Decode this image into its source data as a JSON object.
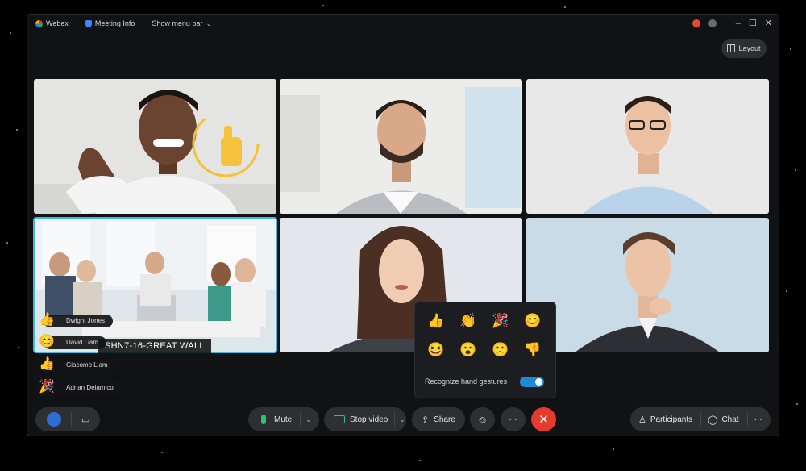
{
  "titlebar": {
    "app_name": "Webex",
    "meeting_info": "Meeting Info",
    "show_menu_bar": "Show menu bar"
  },
  "window_controls": {
    "minimize": "–",
    "maximize": "☐",
    "close": "✕"
  },
  "layout_button": {
    "label": "Layout"
  },
  "room_label": "SHN7-16-GREAT WALL",
  "participants_overlay": [
    {
      "name": "Dwight Jones",
      "emoji": "👍"
    },
    {
      "name": "David Liam",
      "emoji": "😊"
    },
    {
      "name": "Giacomo Liam",
      "emoji": "👍"
    },
    {
      "name": "Adrian Delamico",
      "emoji": "🎉"
    }
  ],
  "reactions_panel": {
    "row1": [
      "👍",
      "👏",
      "🎉",
      "😊"
    ],
    "row2": [
      "😆",
      "😮",
      "🙁",
      "👎"
    ],
    "gesture_label": "Recognize hand gestures",
    "gesture_enabled": true
  },
  "bottombar": {
    "mute_label": "Mute",
    "stop_video_label": "Stop video",
    "share_label": "Share",
    "more_label": "···",
    "participants_label": "Participants",
    "chat_label": "Chat",
    "overflow_label": "···"
  },
  "colors": {
    "accent": "#1d8ad6",
    "end_call": "#e53b2f",
    "active_tile_border": "#3fb8e0"
  }
}
